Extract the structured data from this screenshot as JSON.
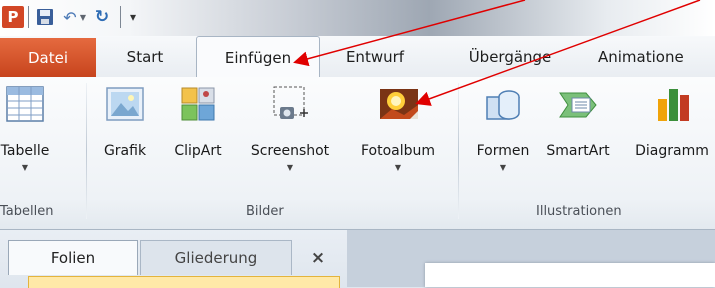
{
  "quick_access": {
    "app_logo": "P",
    "save_icon": "save-icon",
    "undo_icon": "undo-icon",
    "redo_icon": "redo-icon",
    "customize_icon": "customize-icon"
  },
  "tabs": [
    {
      "label": "Datei"
    },
    {
      "label": "Start"
    },
    {
      "label": "Einfügen",
      "active": true
    },
    {
      "label": "Entwurf"
    },
    {
      "label": "Übergänge"
    },
    {
      "label": "Animatione"
    }
  ],
  "ribbon": {
    "groups": [
      {
        "label": "Tabellen"
      },
      {
        "label": "Bilder"
      },
      {
        "label": "Illustrationen"
      }
    ],
    "buttons": [
      {
        "label": "Tabelle",
        "icon": "table-icon",
        "dropdown": true
      },
      {
        "label": "Grafik",
        "icon": "picture-icon"
      },
      {
        "label": "ClipArt",
        "icon": "clipart-icon"
      },
      {
        "label": "Screenshot",
        "icon": "screenshot-icon",
        "dropdown": true
      },
      {
        "label": "Fotoalbum",
        "icon": "photo-album-icon",
        "dropdown": true
      },
      {
        "label": "Formen",
        "icon": "shapes-icon",
        "dropdown": true
      },
      {
        "label": "SmartArt",
        "icon": "smartart-icon"
      },
      {
        "label": "Diagramm",
        "icon": "chart-icon"
      }
    ]
  },
  "pane": {
    "tab_slides": "Folien",
    "tab_outline": "Gliederung",
    "close_glyph": "×"
  },
  "colors": {
    "file_tab": "#d24726",
    "annotation_arrow": "#e00000"
  }
}
